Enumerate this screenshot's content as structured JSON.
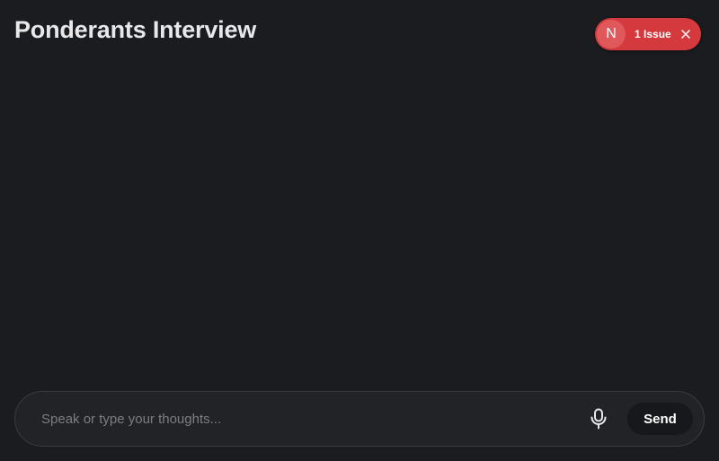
{
  "header": {
    "title": "Ponderants Interview"
  },
  "issue_badge": {
    "logo_letter": "N",
    "label": "1 Issue",
    "close_icon": "close-icon",
    "color": "#d43a3d"
  },
  "composer": {
    "placeholder": "Speak or type your thoughts...",
    "value": "",
    "mic_icon": "microphone-icon",
    "send_label": "Send"
  },
  "colors": {
    "background": "#1b1c20",
    "input_background": "#222327",
    "send_button": "#17181b"
  }
}
